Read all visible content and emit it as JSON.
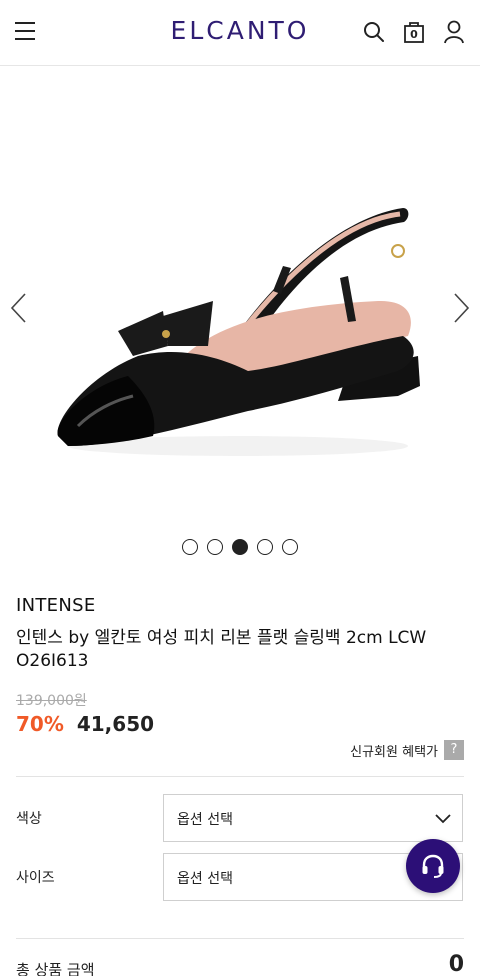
{
  "header": {
    "logo": "ELCANTO",
    "cart_count": "0",
    "icons": [
      "menu-icon",
      "search-icon",
      "shopping-bag-icon",
      "user-icon"
    ]
  },
  "gallery": {
    "total_slides": 5,
    "active_slide": 3
  },
  "product": {
    "brand": "INTENSE",
    "title": "인텐스 by 엘칸토 여성 피치 리본 플랫 슬링백 2cm LCW O26I613",
    "original_price": "139,000원",
    "discount": "70%",
    "price": "41,650",
    "benefit_label": "신규회원 혜택가",
    "benefit_help": "?"
  },
  "options": {
    "color_label": "색상",
    "color_value": "옵션 선택",
    "size_label": "사이즈",
    "size_value": "옵션 선택"
  },
  "total": {
    "label": "총 상품 금액",
    "value": "0"
  },
  "colors": {
    "brand": "#2f1d73",
    "discount": "#f05a28",
    "cs_button": "#2c0f77"
  }
}
